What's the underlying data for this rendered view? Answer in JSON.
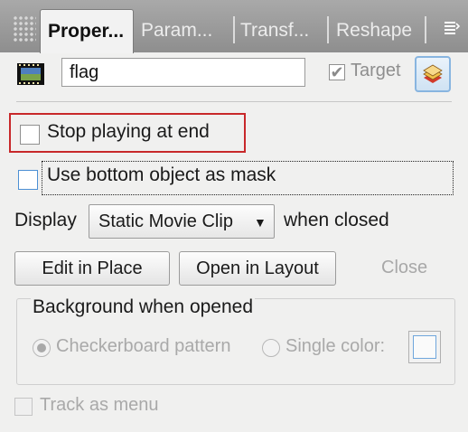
{
  "tabs": [
    {
      "label": "Proper...",
      "active": true
    },
    {
      "label": "Param...",
      "active": false
    },
    {
      "label": "Transf...",
      "active": false
    },
    {
      "label": "Reshape",
      "active": false
    }
  ],
  "object": {
    "name_value": "flag",
    "target_label": "Target",
    "target_checked": true
  },
  "options": {
    "stop_playing_label": "Stop playing at end",
    "stop_playing_checked": false,
    "mask_label": "Use bottom object as mask",
    "mask_checked": false
  },
  "display": {
    "label": "Display",
    "selected_option": "Static Movie Clip",
    "suffix": "when closed"
  },
  "buttons": {
    "edit_label": "Edit in Place",
    "open_label": "Open in Layout",
    "close_label": "Close"
  },
  "background": {
    "title": "Background when opened",
    "checker_label": "Checkerboard pattern",
    "single_label": "Single color:",
    "selected": "checkerboard"
  },
  "track": {
    "label": "Track as menu",
    "checked": false
  },
  "colors": {
    "highlight_border": "#c8282a",
    "focus_blue": "#4c8fd4",
    "disabled_text": "#a9a9a9"
  },
  "icons": {
    "movie": "film-strip-icon",
    "target": "layers-target-icon",
    "menu": "panel-menu-icon"
  }
}
